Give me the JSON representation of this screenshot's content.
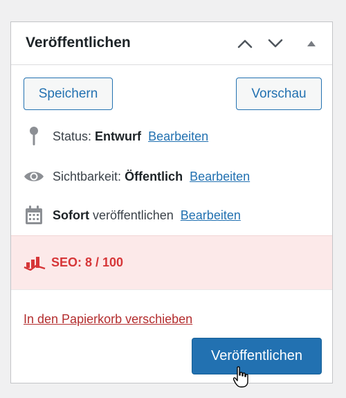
{
  "panel": {
    "title": "Veröffentlichen",
    "header_buttons": [
      "chevron-up-icon",
      "chevron-down-icon",
      "collapse-triangle-icon"
    ]
  },
  "actions": {
    "save_label": "Speichern",
    "preview_label": "Vorschau"
  },
  "status": {
    "label": "Status:",
    "value": "Entwurf",
    "edit_link": "Bearbeiten",
    "icon": "pin-icon"
  },
  "visibility": {
    "label": "Sichtbarkeit:",
    "value": "Öffentlich",
    "edit_link": "Bearbeiten",
    "icon": "eye-icon"
  },
  "schedule": {
    "value": "Sofort",
    "label": "veröffentlichen",
    "edit_link": "Bearbeiten",
    "icon": "calendar-icon"
  },
  "seo": {
    "label": "SEO: 8 / 100",
    "icon": "seo-chart-icon",
    "color": "#d63638"
  },
  "footer": {
    "trash_link": "In den Papierkorb verschieben",
    "publish_label": "Veröffentlichen"
  },
  "colors": {
    "accent": "#2271b1",
    "danger": "#b32d2e",
    "seo_bg": "#fce9e9"
  }
}
